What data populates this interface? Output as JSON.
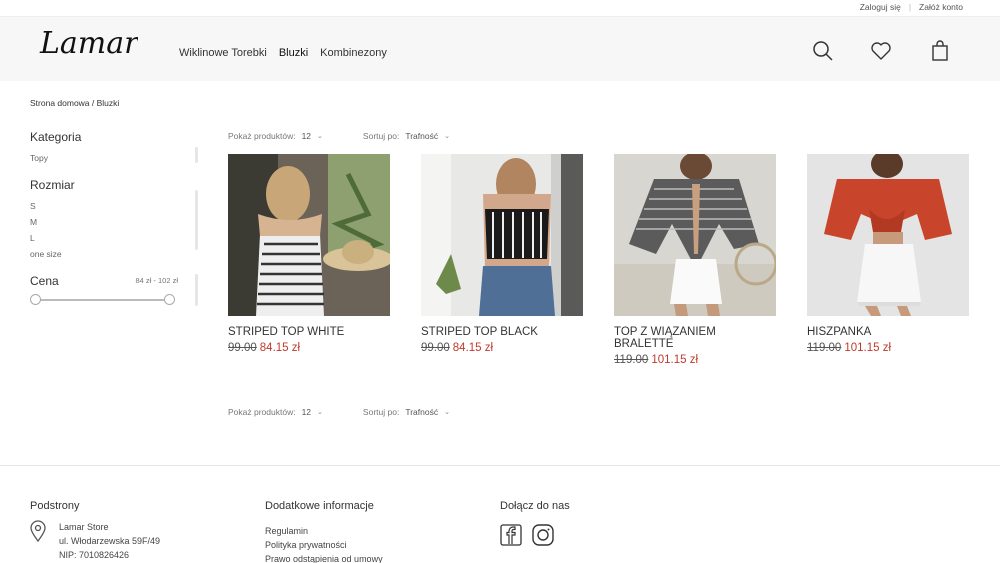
{
  "topbar": {
    "login": "Zaloguj się",
    "register": "Załóż konto"
  },
  "header": {
    "logo_text": "Lamar.",
    "nav": [
      "Wiklinowe Torebki",
      "Bluzki",
      "Kombinezony"
    ],
    "icons": [
      "search-icon",
      "heart-icon",
      "bag-icon"
    ]
  },
  "breadcrumb": "Strona domowa / Bluzki",
  "filters": {
    "category": {
      "title": "Kategoria",
      "items": [
        "Topy"
      ]
    },
    "size": {
      "title": "Rozmiar",
      "items": [
        "S",
        "M",
        "L",
        "one size"
      ]
    },
    "price": {
      "title": "Cena",
      "range": "84 zł - 102 zł",
      "min": 0,
      "max": 1
    }
  },
  "toolbar": {
    "show_label": "Pokaż produktów:",
    "show_value": "12",
    "sort_label": "Sortuj po:",
    "sort_value": "Trafność"
  },
  "products": [
    {
      "name": "STRIPED TOP WHITE",
      "old_price": "99.00",
      "new_price": "84.15 zł"
    },
    {
      "name": "STRIPED TOP BLACK",
      "old_price": "99.00",
      "new_price": "84.15 zł"
    },
    {
      "name": "TOP Z WIĄZANIEM BRALETTE",
      "old_price": "119.00",
      "new_price": "101.15 zł"
    },
    {
      "name": "HISZPANKA",
      "old_price": "119.00",
      "new_price": "101.15 zł"
    }
  ],
  "footer": {
    "col1": {
      "title": "Podstrony",
      "address": [
        "Lamar Store",
        "ul. Włodarzewska 59F/49",
        "NIP: 7010826426"
      ]
    },
    "col2": {
      "title": "Dodatkowe informacje",
      "links": [
        "Regulamin",
        "Polityka prywatności",
        "Prawo odstąpienia od umowy"
      ]
    },
    "col3": {
      "title": "Dołącz do nas",
      "icons": [
        "facebook-icon",
        "instagram-icon"
      ]
    }
  },
  "colors": {
    "sale": "#c0392b",
    "header_bg": "#f7f7f7"
  }
}
